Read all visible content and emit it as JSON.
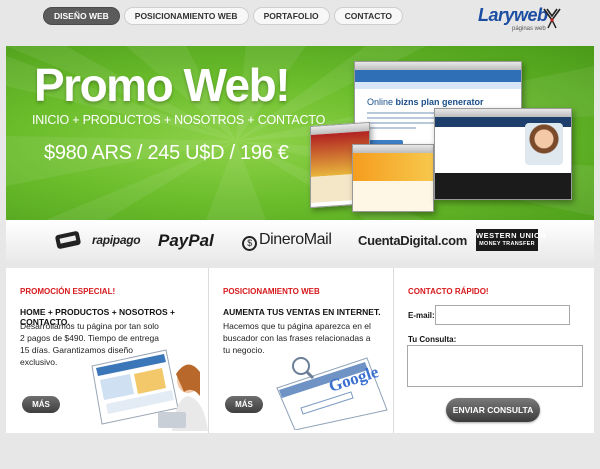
{
  "nav": {
    "items": [
      {
        "label": "DISEÑO WEB",
        "active": true
      },
      {
        "label": "POSICIONAMIENTO WEB",
        "active": false
      },
      {
        "label": "PORTAFOLIO",
        "active": false
      },
      {
        "label": "CONTACTO",
        "active": false
      }
    ]
  },
  "brand": {
    "name": "Laryweb",
    "tagline": "páginas web",
    "color": "#1b4ea3"
  },
  "banner": {
    "title": "Promo Web!",
    "subtitle": "INICIO + PRODUCTOS + NOSOTROS + CONTACTO",
    "price": "$980 ARS / 245 U$D / 196 €",
    "mockup_heading_1": "Online",
    "mockup_heading_2": "bizns plan generator",
    "colors": {
      "green_light": "#8fd24a",
      "green_dark": "#4a9a18"
    }
  },
  "payments": {
    "items": [
      "rapipago",
      "PayPal",
      "DineroMail",
      "CuentaDigital.com",
      "WESTERN UNION",
      "MONEY TRANSFER"
    ]
  },
  "sections": {
    "promo": {
      "title": "PROMOCIÓN ESPECIAL!",
      "lead": "HOME + PRODUCTOS + NOSOTROS + CONTACTO.",
      "body": "Desarrollamos tu página por tan solo 2 pagos de $490. Tiempo de entrega 15 días. Garantizamos diseño exclusivo.",
      "more_label": "MÁS"
    },
    "seo": {
      "title": "POSICIONAMIENTO WEB",
      "lead": "AUMENTA TUS VENTAS EN INTERNET.",
      "body": "Hacemos que tu página aparezca en el buscador con las frases relacionadas a tu negocio.",
      "more_label": "MÁS",
      "search_brand": "Google"
    },
    "contact": {
      "title": "CONTACTO RÁPIDO!",
      "email_label": "E-mail:",
      "email_value": "",
      "message_label": "Tu Consulta:",
      "message_value": "",
      "submit_label": "ENVIAR CONSULTA"
    }
  },
  "accent": "#d7191c"
}
